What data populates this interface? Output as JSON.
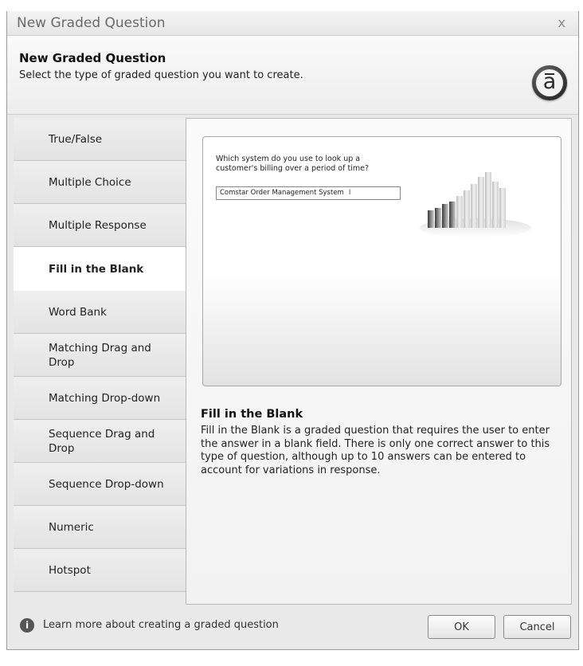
{
  "window": {
    "title": "New Graded Question",
    "close_label": "x"
  },
  "header": {
    "title": "New Graded Question",
    "subtitle": "Select the type of graded question you want to create.",
    "logo_letter": "a"
  },
  "sidebar": {
    "selected": "Fill in the Blank",
    "items": [
      {
        "label": "True/False"
      },
      {
        "label": "Multiple Choice"
      },
      {
        "label": "Multiple Response"
      },
      {
        "label": "Fill in the Blank"
      },
      {
        "label": "Word Bank"
      },
      {
        "label": "Matching Drag and Drop"
      },
      {
        "label": "Matching Drop-down"
      },
      {
        "label": "Sequence Drag and Drop"
      },
      {
        "label": "Sequence Drop-down"
      },
      {
        "label": "Numeric"
      },
      {
        "label": "Hotspot"
      }
    ]
  },
  "preview": {
    "question": "Which system do you use to look up a customer's billing over a period of time?",
    "answer_value": "Comstar Order Management System"
  },
  "description": {
    "title": "Fill in the Blank",
    "body": "Fill in the Blank is a graded question that requires the user to enter the answer in a blank field. There is only one correct answer to this type of question, although up to 10 answers can be entered to account for variations in response."
  },
  "footer": {
    "learn_more": "Learn more about creating a graded question",
    "ok_label": "OK",
    "cancel_label": "Cancel"
  },
  "icons": {
    "info": "info-icon",
    "close": "close-icon",
    "logo": "app-logo",
    "chart": "bar-chart-illustration"
  }
}
